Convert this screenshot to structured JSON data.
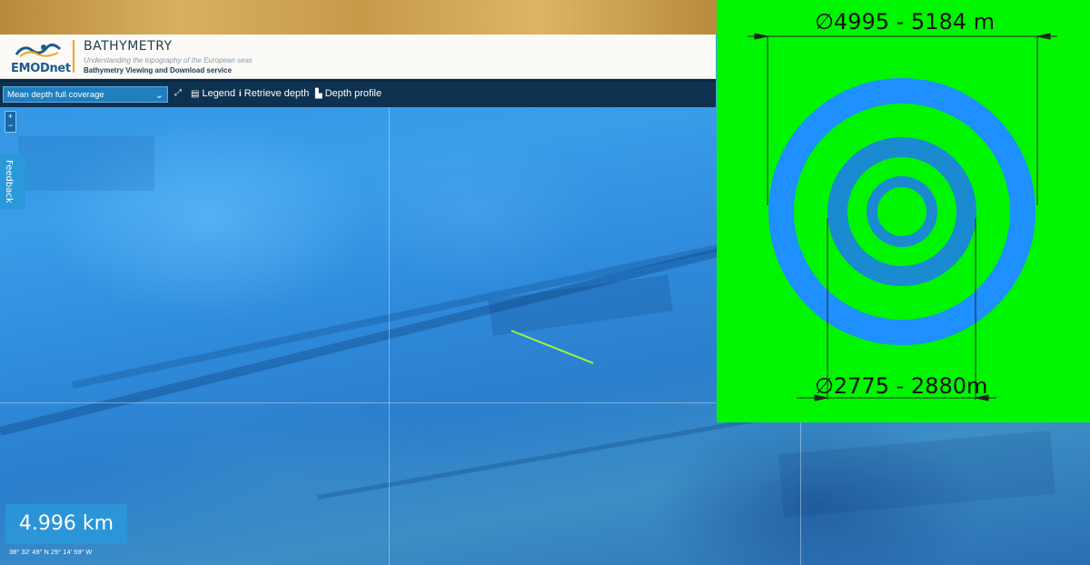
{
  "header": {
    "logo_text": "EMODnet",
    "app_title": "BATHYMETRY",
    "subtitle": "Understanding the topography of the European seas",
    "service_name": "Bathymetry Viewing and Download service"
  },
  "toolbar": {
    "layer_select_value": "Mean depth full coverage",
    "tools": [
      {
        "label": "",
        "icon": "fullscreen-icon"
      },
      {
        "label": "Legend",
        "icon": "legend-icon"
      },
      {
        "label": "Retrieve depth",
        "icon": "info-icon"
      },
      {
        "label": "Depth profile",
        "icon": "chart-icon"
      }
    ]
  },
  "map": {
    "zoom_in": "+",
    "zoom_out": "−",
    "feedback_label": "Feedback",
    "scale_text": "4.996 km",
    "coordinates": "38° 32' 49\" N 29° 14' 59\" W"
  },
  "overlay": {
    "outer_dimension": "4995 - 5184 m",
    "inner_dimension": "2775 - 2880m",
    "diameter_symbol": "∅",
    "colors": {
      "background": "#00f500",
      "ring_light": "#1e90ff",
      "ring_dark": "#1a8bd0",
      "text": "#111111"
    }
  },
  "colors": {
    "toolbar_bg": "#0e3150",
    "select_bg": "#1f7fbf",
    "accent": "#f2a31b",
    "measure_line": "#9cf34a"
  }
}
